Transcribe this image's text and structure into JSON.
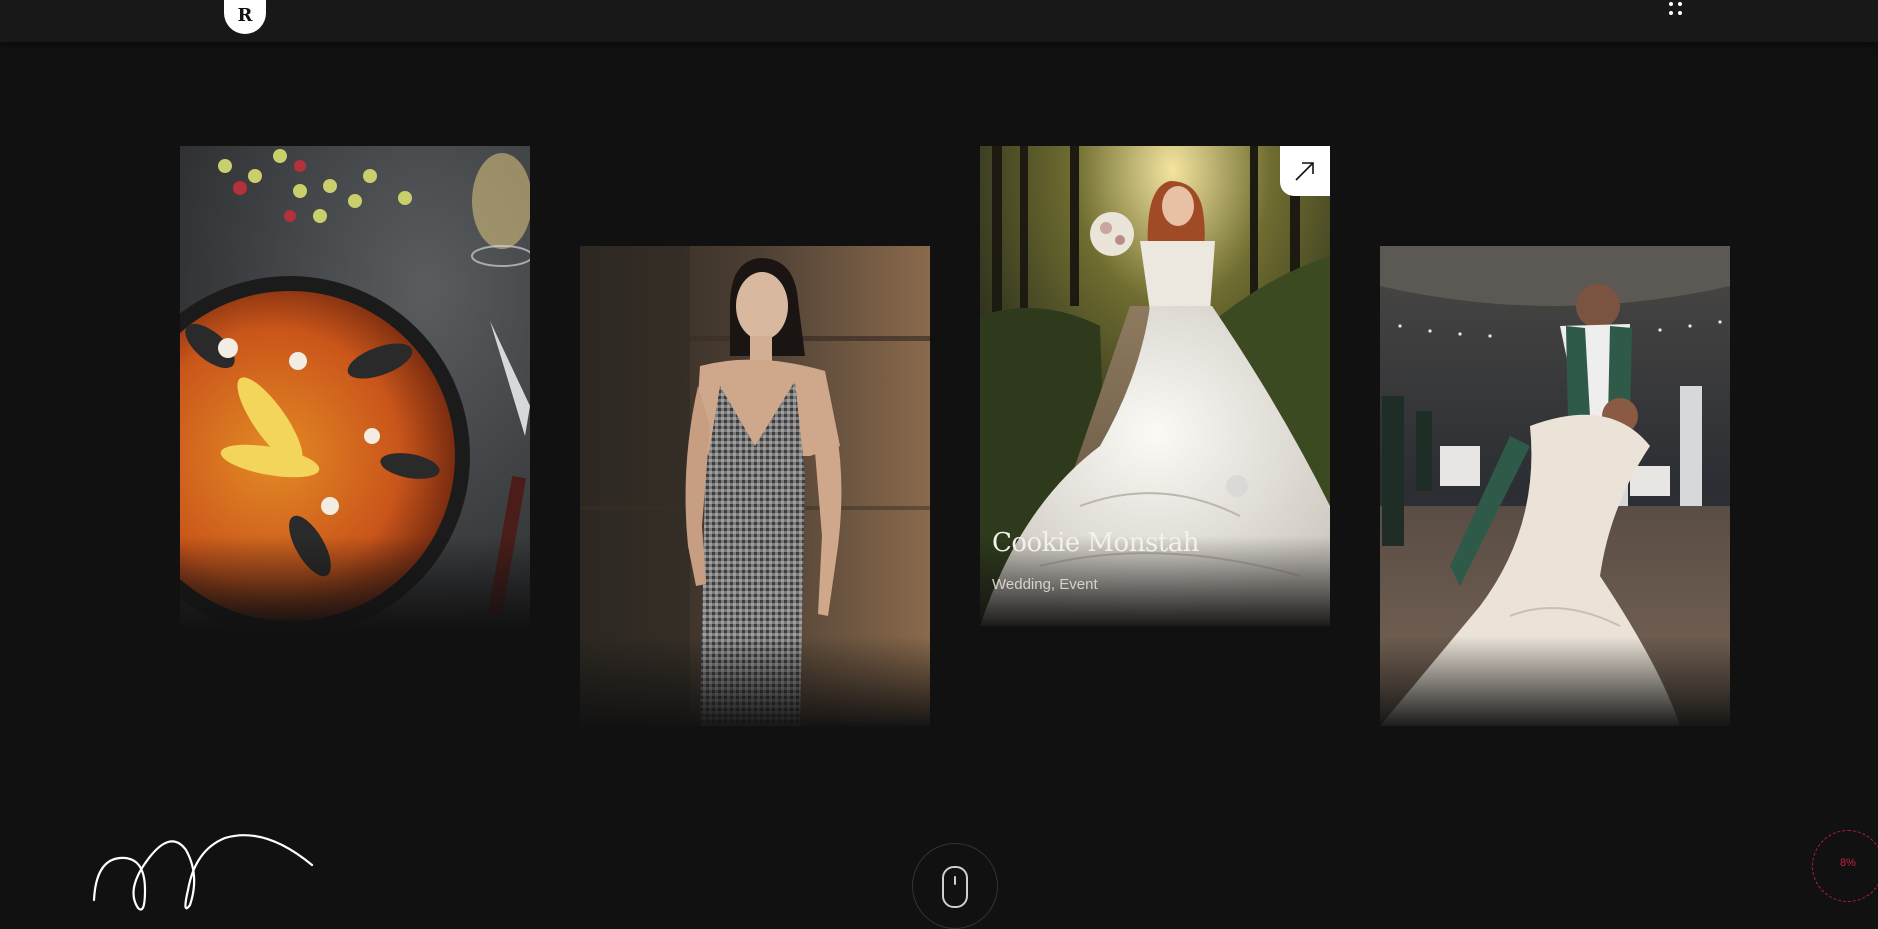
{
  "header": {
    "logo_letter": "R"
  },
  "gallery": {
    "items": [
      {
        "image": "paella-dish-photo"
      },
      {
        "image": "woman-in-checked-jumpsuit-photo"
      },
      {
        "image": "bride-on-forest-path-photo",
        "title": "Cookie Monstah",
        "tags": "Wedding, Event",
        "action_icon": "arrow-up-right-icon"
      },
      {
        "image": "wedding-couple-dancing-photo"
      }
    ]
  },
  "footer": {
    "signature_icon": "signature-icon",
    "scroll_icon": "mouse-scroll-icon",
    "progress_label": "8%",
    "progress_percent": 8
  },
  "colors": {
    "background": "#111111",
    "topbar": "#181818",
    "accent": "#c8203d"
  }
}
